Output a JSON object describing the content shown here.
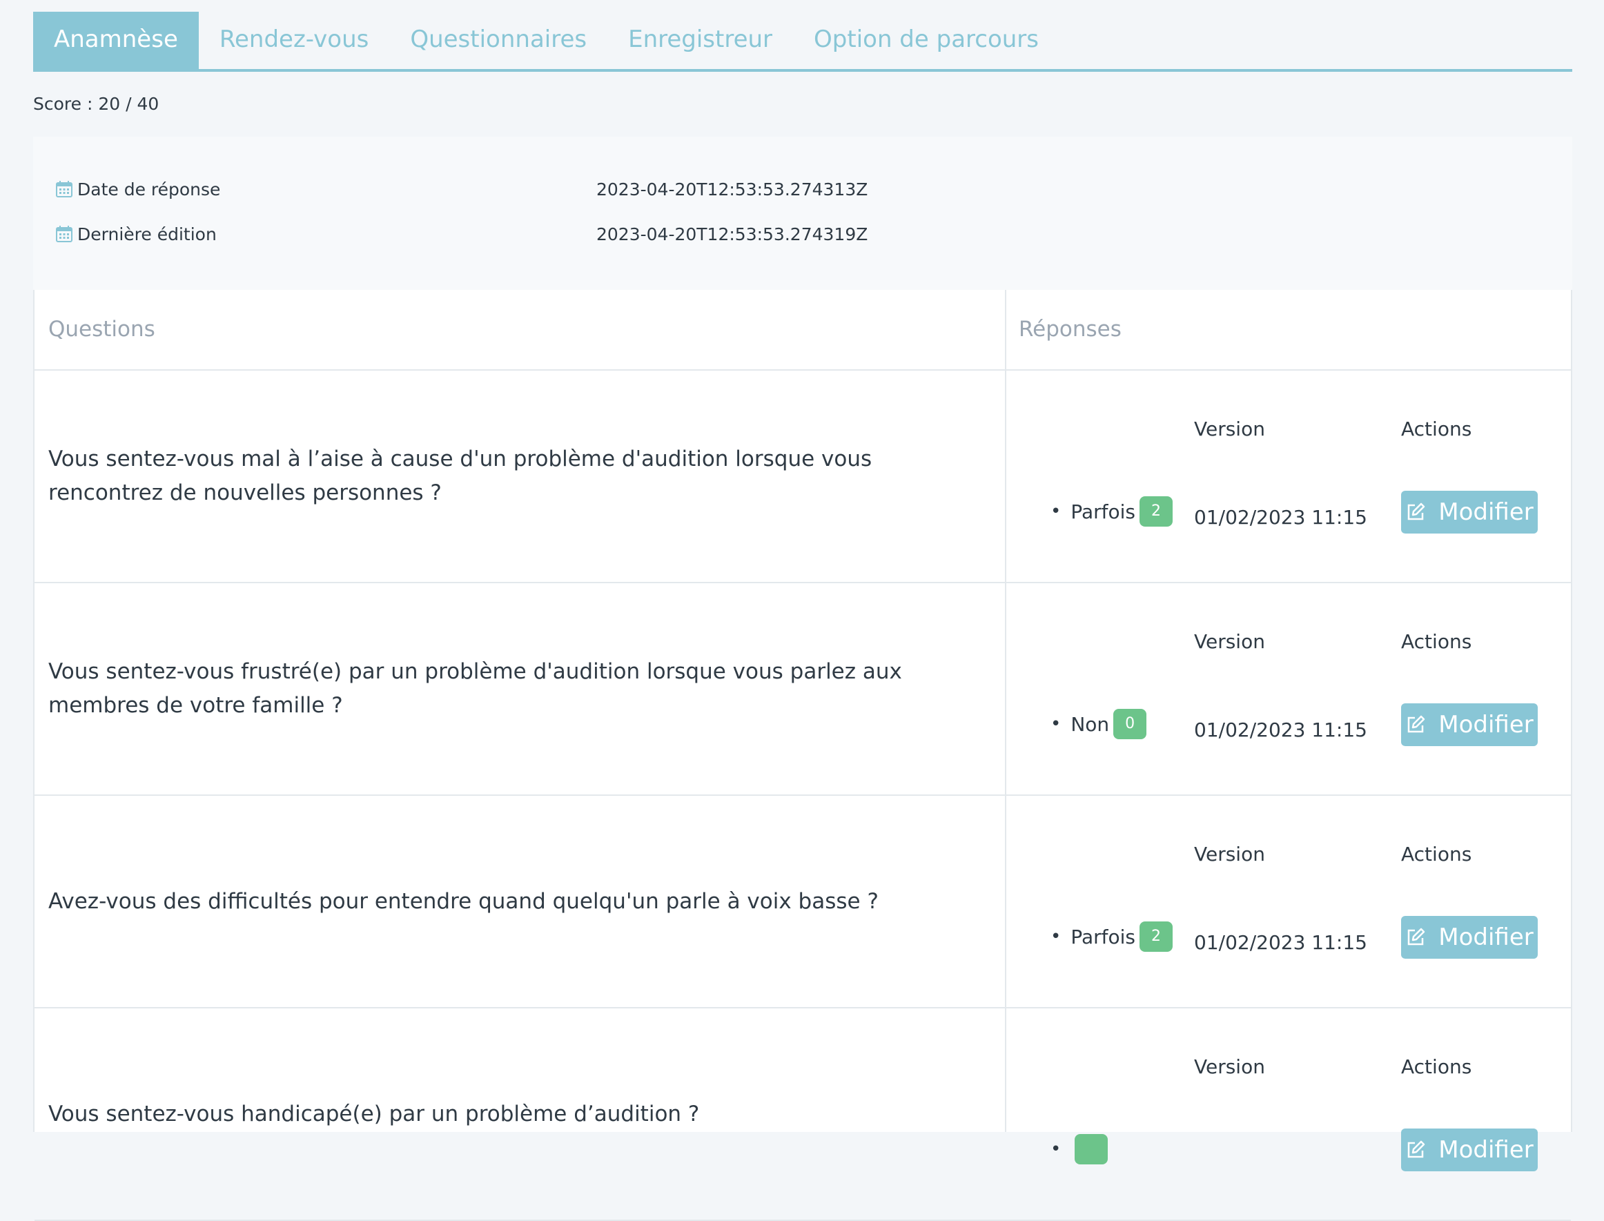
{
  "tabs": [
    "Anamnèse",
    "Rendez-vous",
    "Questionnaires",
    "Enregistreur",
    "Option de parcours"
  ],
  "score_text": "Score : 20 / 40",
  "info": {
    "response_date_label": "Date de réponse",
    "response_date_value": "2023-04-20T12:53:53.274313Z",
    "last_edit_label": "Dernière édition",
    "last_edit_value": "2023-04-20T12:53:53.274319Z"
  },
  "table": {
    "col_questions": "Questions",
    "col_responses": "Réponses",
    "version_label": "Version",
    "actions_label": "Actions",
    "edit_label": "Modifier",
    "rows": [
      {
        "question": "Vous sentez-vous mal à l’aise à cause d'un problème d'audition lorsque vous rencontrez de nouvelles personnes ?",
        "answer": "Parfois",
        "score": "2",
        "version": "01/02/2023 11:15"
      },
      {
        "question": "Vous sentez-vous frustré(e) par un problème d'audition lorsque vous parlez aux membres de votre famille ?",
        "answer": "Non",
        "score": "0",
        "version": "01/02/2023 11:15"
      },
      {
        "question": "Avez-vous des difficultés pour entendre quand quelqu'un parle à voix basse ?",
        "answer": "Parfois",
        "score": "2",
        "version": "01/02/2023 11:15"
      },
      {
        "question": "Vous sentez-vous handicapé(e) par un problème d’audition ?",
        "answer": "",
        "score": "",
        "version": ""
      }
    ]
  },
  "colors": {
    "accent": "#89c6d6",
    "badge_green": "#6cc48a",
    "background": "#f3f6f9"
  }
}
